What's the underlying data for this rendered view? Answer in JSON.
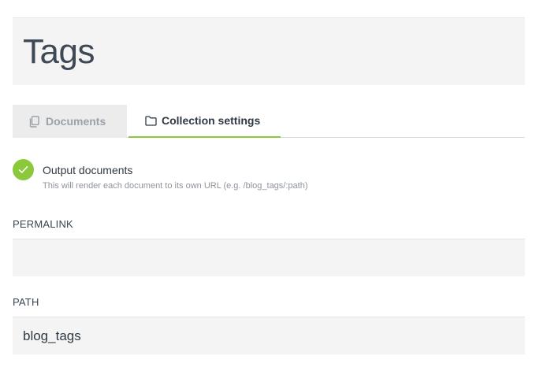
{
  "header": {
    "title": "Tags"
  },
  "tabs": [
    {
      "label": "Documents",
      "icon": "documents-icon",
      "active": false
    },
    {
      "label": "Collection settings",
      "icon": "folder-icon",
      "active": true
    }
  ],
  "output": {
    "label": "Output documents",
    "help": "This will render each document to its own URL (e.g. /blog_tags/:path)",
    "checked": true
  },
  "fields": {
    "permalink": {
      "label": "PERMALINK",
      "value": ""
    },
    "path": {
      "label": "PATH",
      "value": "blog_tags"
    }
  },
  "colors": {
    "accent": "#8cc83c",
    "panel": "#f4f4f4",
    "text": "#3f4955"
  }
}
